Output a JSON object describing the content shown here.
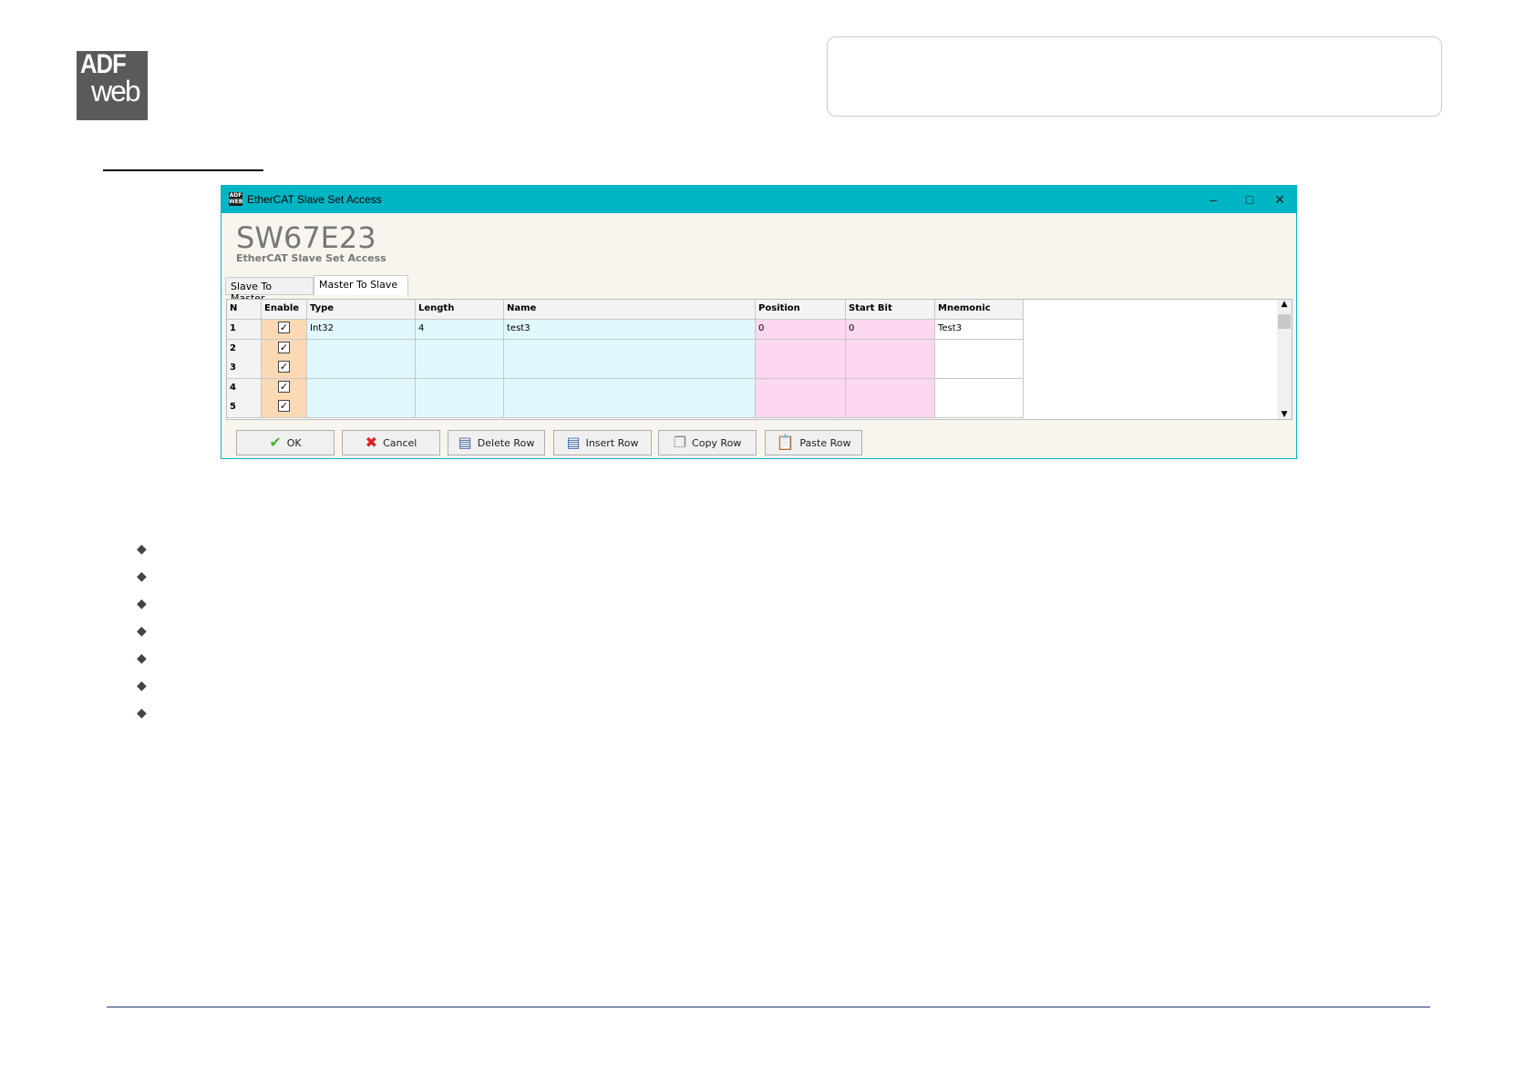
{
  "logo": {
    "text_top": "ADF",
    "text_bottom": "web"
  },
  "window": {
    "title": "EtherCAT Slave Set Access",
    "app_icon_text": "ADF WEB",
    "controls": {
      "minimize": "–",
      "maximize": "□",
      "close": "✕"
    },
    "header_title": "SW67E23",
    "header_subtitle": "EtherCAT Slave Set Access",
    "tabs": [
      {
        "label": "Slave To Master",
        "active": false
      },
      {
        "label": "Master To Slave",
        "active": true
      }
    ],
    "columns": [
      "N",
      "Enable",
      "Type",
      "Length",
      "Name",
      "Position",
      "Start Bit",
      "Mnemonic"
    ],
    "rows": [
      {
        "n": "1",
        "enable": true,
        "type": "Int32",
        "length": "4",
        "name": "test3",
        "position": "0",
        "start_bit": "0",
        "mnemonic": "Test3"
      },
      {
        "n": "2",
        "enable": true,
        "type": "",
        "length": "",
        "name": "",
        "position": "",
        "start_bit": "",
        "mnemonic": ""
      },
      {
        "n": "3",
        "enable": true,
        "type": "",
        "length": "",
        "name": "",
        "position": "",
        "start_bit": "",
        "mnemonic": ""
      },
      {
        "n": "4",
        "enable": true,
        "type": "",
        "length": "",
        "name": "",
        "position": "",
        "start_bit": "",
        "mnemonic": ""
      },
      {
        "n": "5",
        "enable": true,
        "type": "",
        "length": "",
        "name": "",
        "position": "",
        "start_bit": "",
        "mnemonic": ""
      }
    ],
    "buttons": {
      "ok": "OK",
      "cancel": "Cancel",
      "delete_row": "Delete Row",
      "insert_row": "Insert Row",
      "copy_row": "Copy Row",
      "paste_row": "Paste Row"
    }
  },
  "colors": {
    "titlebar": "#00b6c4",
    "enable_col": "#fcd9b5",
    "cyan_cols": "#e0f7fb",
    "pink_cols": "#fbd7f0"
  }
}
